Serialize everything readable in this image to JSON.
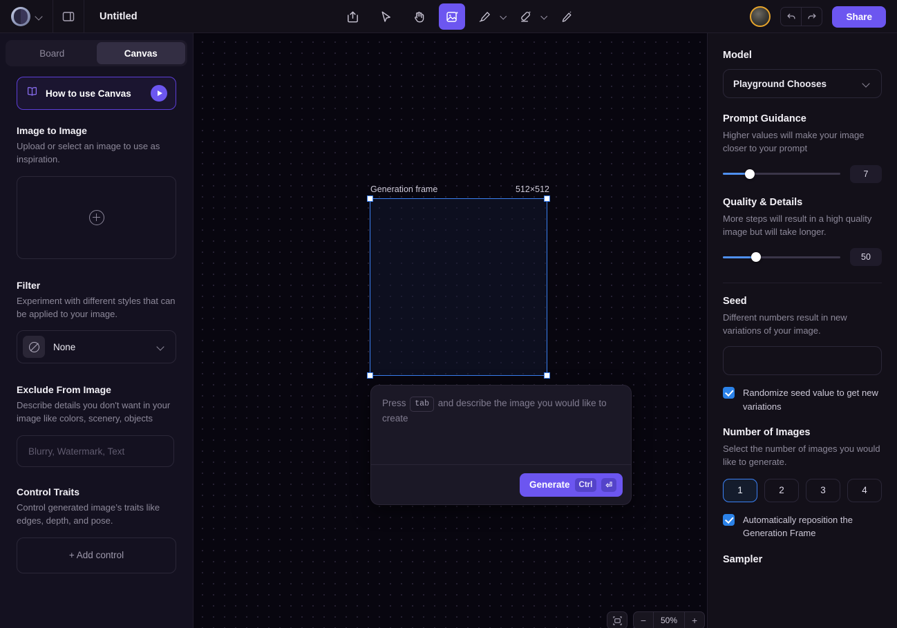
{
  "topbar": {
    "title": "Untitled",
    "logo_icon": "playground-logo-icon",
    "account_chevron_icon": "chevron-down-icon",
    "sidebar_toggle_icon": "panel-toggle-icon",
    "tools": [
      {
        "name": "upload-export-tool",
        "icon": "upload-arrow-icon",
        "active": false,
        "chevron": false
      },
      {
        "name": "select-tool",
        "icon": "cursor-arrow-icon",
        "active": false,
        "chevron": false
      },
      {
        "name": "hand-tool",
        "icon": "hand-icon",
        "active": false,
        "chevron": false
      },
      {
        "name": "generate-image-tool",
        "icon": "image-sparkle-icon",
        "active": true,
        "chevron": false
      },
      {
        "name": "draw-tool",
        "icon": "pen-draw-icon",
        "active": false,
        "chevron": true
      },
      {
        "name": "erase-tool",
        "icon": "eraser-icon",
        "active": false,
        "chevron": true
      },
      {
        "name": "edit-tool",
        "icon": "pencil-edit-icon",
        "active": false,
        "chevron": false
      }
    ],
    "avatar_name": "user-avatar",
    "undo_icon": "undo-arrow-icon",
    "redo_icon": "redo-arrow-icon",
    "share_label": "Share"
  },
  "sidebar": {
    "tabs": [
      {
        "label": "Board",
        "active": false
      },
      {
        "label": "Canvas",
        "active": true
      }
    ],
    "howto": {
      "label": "How to use Canvas",
      "book_icon": "book-icon",
      "play_icon": "play-icon"
    },
    "sections": {
      "image_to_image": {
        "title": "Image to Image",
        "desc": "Upload or select an image to use as inspiration.",
        "upload_icon": "plus-circle-icon"
      },
      "filter": {
        "title": "Filter",
        "desc": "Experiment with different styles that can be applied to your image.",
        "value": "None",
        "swatch_icon": "no-filter-icon",
        "chevron_icon": "chevron-down-icon"
      },
      "exclude": {
        "title": "Exclude From Image",
        "desc": "Describe details you don't want in your image like colors, scenery, objects",
        "placeholder": "Blurry, Watermark, Text",
        "value": ""
      },
      "control_traits": {
        "title": "Control Traits",
        "desc": "Control generated image’s traits like edges, depth, and pose.",
        "add_label": "+  Add control"
      }
    }
  },
  "canvas": {
    "frame_label": "Generation frame",
    "frame_size": "512×512",
    "prompt": {
      "placeholder_before": "Press",
      "kbd_tab": "tab",
      "placeholder_after": "and describe the image you would like to create",
      "value": "",
      "generate_label": "Generate",
      "generate_kbd_ctrl": "Ctrl",
      "generate_kbd_enter": "⏎"
    },
    "zoom": {
      "fit_icon": "fit-to-frame-icon",
      "minus": "−",
      "level": "50%",
      "plus": "+"
    }
  },
  "right_panel": {
    "model": {
      "title": "Model",
      "value": "Playground Chooses",
      "chevron_icon": "chevron-down-icon"
    },
    "prompt_guidance": {
      "title": "Prompt Guidance",
      "desc": "Higher values will make your image closer to your prompt",
      "value": "7",
      "fill_percent": 23
    },
    "quality": {
      "title": "Quality & Details",
      "desc": "More steps will result in a high quality image but will take longer.",
      "value": "50",
      "fill_percent": 28
    },
    "seed": {
      "title": "Seed",
      "desc": "Different numbers result in new variations of your image.",
      "value": "",
      "placeholder": "",
      "randomize_label": "Randomize seed value to get new variations",
      "randomize_checked": true
    },
    "number_of_images": {
      "title": "Number of Images",
      "desc": "Select the number of images you would like to generate.",
      "options": [
        "1",
        "2",
        "3",
        "4"
      ],
      "selected": "1",
      "auto_reposition_label": "Automatically reposition the Generation Frame",
      "auto_reposition_checked": true
    },
    "sampler": {
      "title": "Sampler"
    }
  },
  "colors": {
    "accent_purple": "#6c56f0",
    "accent_blue": "#3b82f6",
    "checkbox_blue": "#2b82e8",
    "avatar_ring": "#e8a52b"
  }
}
